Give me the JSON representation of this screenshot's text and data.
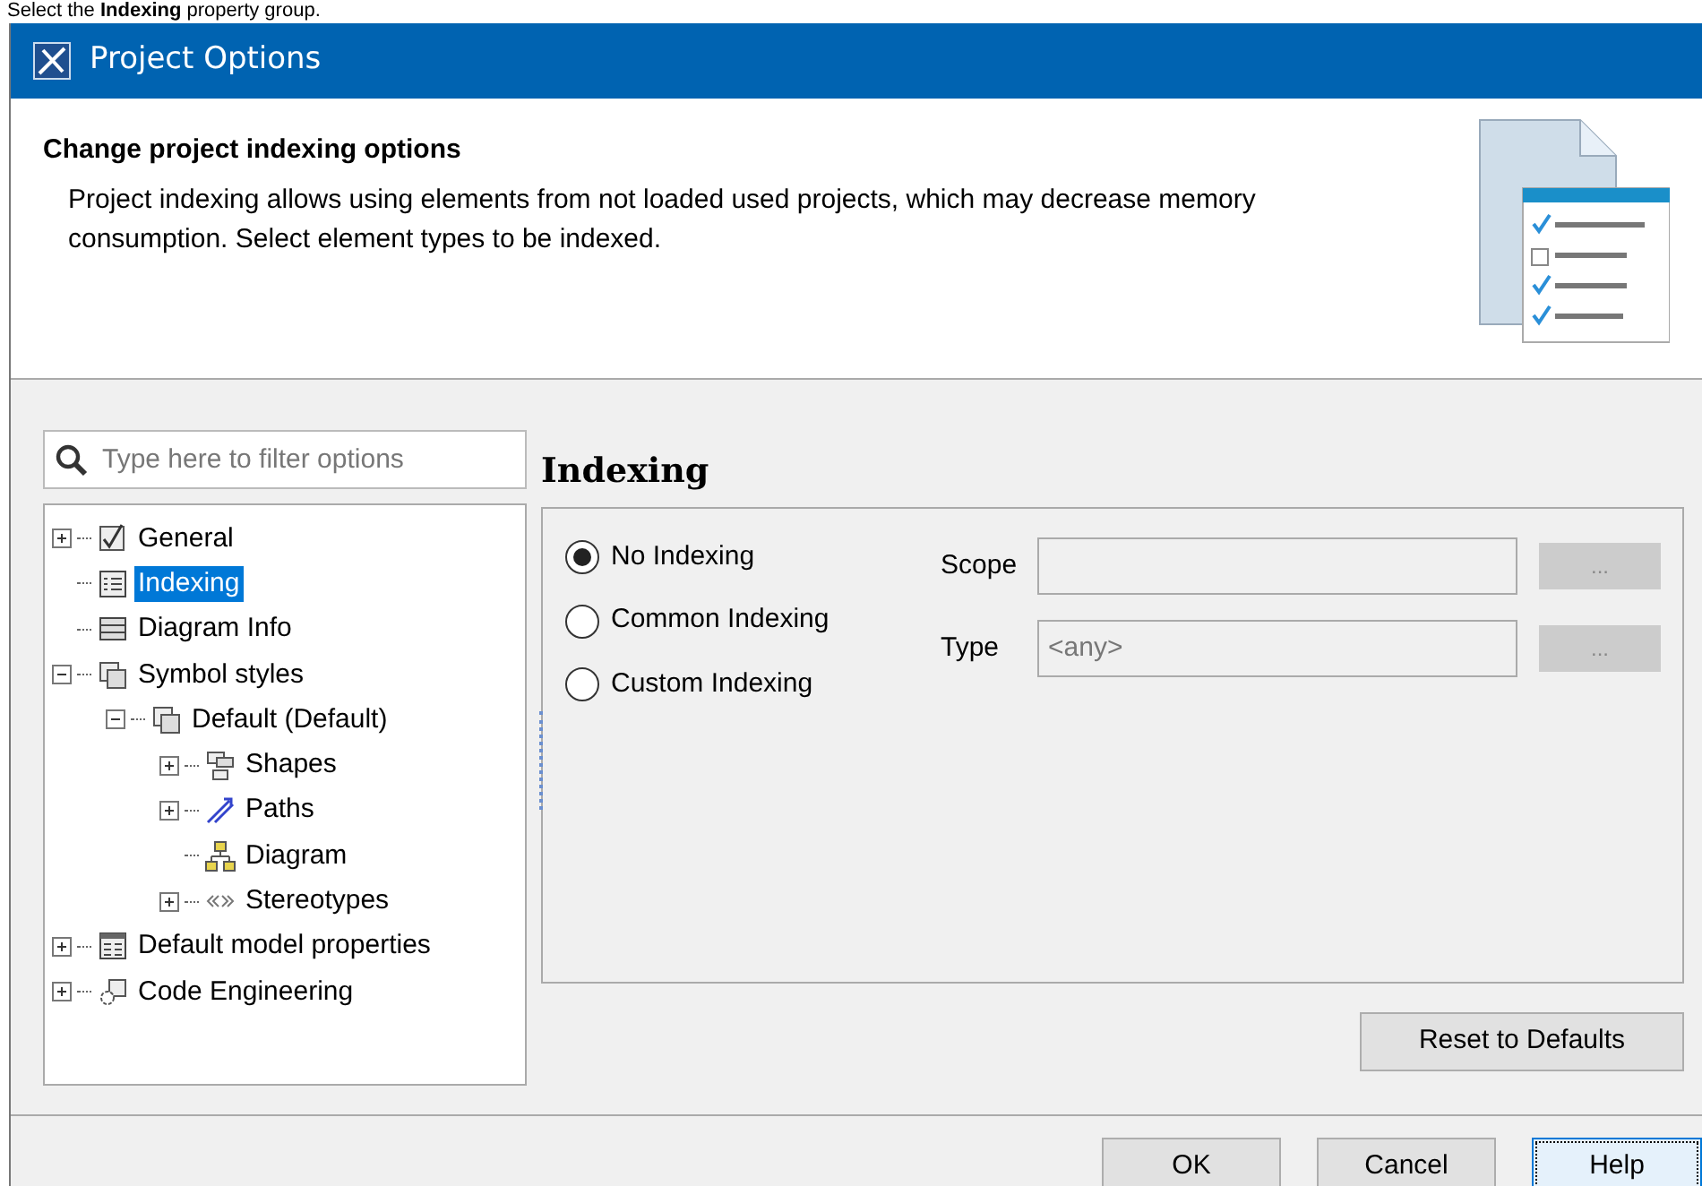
{
  "caption": "Select the **Indexing** property group.",
  "window": {
    "title": "Project Options"
  },
  "header": {
    "title": "Change project indexing options",
    "description": "Project indexing allows using elements from not loaded used projects, which may decrease memory consumption. Select element types to be indexed."
  },
  "filter": {
    "placeholder": "Type here to filter options"
  },
  "tree": [
    {
      "label": "General",
      "kind": "check",
      "expanded": false,
      "selected": false
    },
    {
      "label": "Indexing",
      "kind": "list",
      "selected": true
    },
    {
      "label": "Diagram Info",
      "kind": "table",
      "selected": false
    },
    {
      "label": "Symbol styles",
      "kind": "copy",
      "expanded": true,
      "selected": false,
      "children": [
        {
          "label": "Default (Default)",
          "kind": "copy",
          "expanded": true,
          "selected": false,
          "children": [
            {
              "label": "Shapes",
              "kind": "shapes",
              "expanded": false,
              "selected": false
            },
            {
              "label": "Paths",
              "kind": "paths",
              "expanded": false,
              "selected": false
            },
            {
              "label": "Diagram",
              "kind": "hierarchy",
              "selected": false
            },
            {
              "label": "Stereotypes",
              "kind": "stereotype",
              "expanded": false,
              "selected": false
            }
          ]
        }
      ]
    },
    {
      "label": "Default model properties",
      "kind": "properties",
      "expanded": false,
      "selected": false
    },
    {
      "label": "Code Engineering",
      "kind": "code",
      "expanded": false,
      "selected": false
    }
  ],
  "panel": {
    "title": "Indexing",
    "options": [
      {
        "label": "No Indexing",
        "selected": true
      },
      {
        "label": "Common Indexing",
        "selected": false
      },
      {
        "label": "Custom Indexing",
        "selected": false
      }
    ],
    "fields": [
      {
        "label": "Scope",
        "button": "..."
      },
      {
        "label": "Type",
        "value": "<any>",
        "button": "..."
      }
    ],
    "reset_button": "Reset to Defaults"
  },
  "buttons": [
    {
      "label": "OK",
      "focused": false
    },
    {
      "label": "Cancel",
      "focused": false
    },
    {
      "label": "Help",
      "focused": true
    }
  ]
}
